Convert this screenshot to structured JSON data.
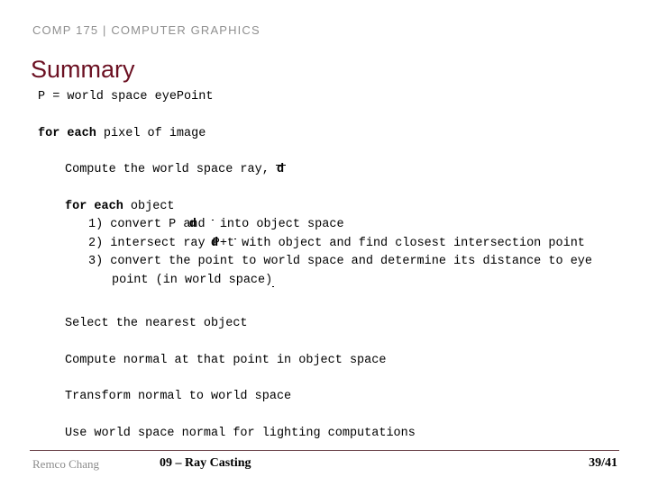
{
  "header": {
    "course": "COMP 175 | COMPUTER GRAPHICS",
    "color": "#8f8f8f"
  },
  "title": {
    "text": "Summary",
    "color": "#6b1022"
  },
  "body": {
    "line_eyepoint": "P = world space eyePoint",
    "loop_pixel": {
      "keyword": "for each",
      "rest": " pixel of image"
    },
    "compute_ray": {
      "text": "Compute the world space ray, ",
      "vector": "d"
    },
    "loop_object": {
      "keyword": "for each",
      "rest": " object"
    },
    "steps": [
      {
        "number": "1)",
        "text_before": " convert P and ",
        "vector": "d",
        "text_after": " into object space"
      },
      {
        "number": "2)",
        "text_before": " intersect ray P+t",
        "vector": "d",
        "text_after": " with object and find closest intersection point"
      },
      {
        "number": "3)",
        "text_before": " convert the point to world space and determine its distance to eye point (in world space)",
        "vector": "",
        "text_after": ""
      }
    ],
    "select_nearest": "Select the nearest object",
    "compute_normal": "Compute normal at that point in object space",
    "transform_normal": "Transform normal to world space",
    "use_normal": "Use world space normal for lighting computations"
  },
  "footer": {
    "author": "Remco Chang",
    "lecture": "09 – Ray Casting",
    "page": "39/41",
    "rule_color": "#6b4349"
  }
}
